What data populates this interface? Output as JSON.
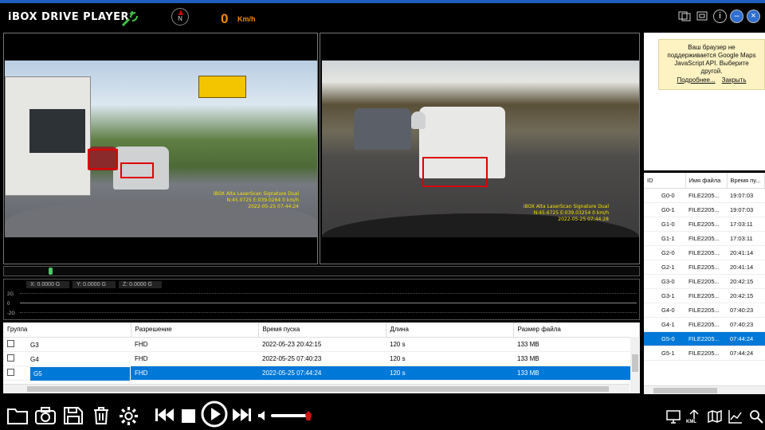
{
  "app": {
    "title": "iBOX DRIVE PLAYER",
    "compass_label": "N",
    "speed_value": "0",
    "speed_unit": "Km/h"
  },
  "video_left": {
    "overlay_line1": "iBOX Alta LaserScan Signature Dual",
    "overlay_line2": "N:45.0725  E:039.0264  0 km/h",
    "overlay_line3": "2022-05-25 07:44:24"
  },
  "video_right": {
    "overlay_line1": "iBOX Alta LaserScan Signature Dual",
    "overlay_line2": "N:45.6725  E:039.03254  0 km/h",
    "overlay_line3": "2022-05-25 07:44:28"
  },
  "gsensor": {
    "x_readout": "X: 0.0000 G",
    "y_readout": "Y: 0.0000 G",
    "z_readout": "Z: 0.0000 G",
    "scale_top": "2G",
    "scale_mid": "0",
    "scale_bottom": "-2G"
  },
  "file_table": {
    "headers": [
      "Группа",
      "Разрешение",
      "Время пуска",
      "Длина",
      "Размер файла"
    ],
    "rows": [
      {
        "group": "G3",
        "resolution": "FHD",
        "start": "2022-05-23 20:42:15",
        "length": "120 s",
        "size": "133 MB"
      },
      {
        "group": "G4",
        "resolution": "FHD",
        "start": "2022-05-25 07:40:23",
        "length": "120 s",
        "size": "133 MB"
      },
      {
        "group": "G5",
        "resolution": "FHD",
        "start": "2022-05-25 07:44:24",
        "length": "120 s",
        "size": "133 MB"
      }
    ]
  },
  "map": {
    "message": "Ваш браузер не поддерживается Google Maps JavaScript API. Выберите другой.",
    "more_link": "Подробнее...",
    "close_link": "Закрыть"
  },
  "file_list": {
    "headers": [
      "ID",
      "Имя файла",
      "Время пу..."
    ],
    "rows": [
      {
        "id": "G0-0",
        "name": "FILE2205...",
        "time": "19:07:03"
      },
      {
        "id": "G0-1",
        "name": "FILE2205...",
        "time": "19:07:03"
      },
      {
        "id": "G1-0",
        "name": "FILE2205...",
        "time": "17:03:11"
      },
      {
        "id": "G1-1",
        "name": "FILE2205...",
        "time": "17:03:11"
      },
      {
        "id": "G2-0",
        "name": "FILE2205...",
        "time": "20:41:14"
      },
      {
        "id": "G2-1",
        "name": "FILE2205...",
        "time": "20:41:14"
      },
      {
        "id": "G3-0",
        "name": "FILE2205...",
        "time": "20:42:15"
      },
      {
        "id": "G3-1",
        "name": "FILE2205...",
        "time": "20:42:15"
      },
      {
        "id": "G4-0",
        "name": "FILE2205...",
        "time": "07:40:23"
      },
      {
        "id": "G4-1",
        "name": "FILE2205...",
        "time": "07:40:23"
      },
      {
        "id": "G5-0",
        "name": "FILE2205...",
        "time": "07:44:24"
      },
      {
        "id": "G5-1",
        "name": "FILE2205...",
        "time": "07:44:24"
      }
    ],
    "selected_index": 10
  },
  "controls": {
    "kml_label": "KML",
    "icons": [
      "folder-icon",
      "camera-icon",
      "save-icon",
      "trash-icon",
      "settings-icon",
      "previous-icon",
      "stop-icon",
      "play-icon",
      "next-icon",
      "volume-icon"
    ],
    "right_icons": [
      "window-icon",
      "kml-icon",
      "map-icon",
      "chart-icon",
      "search-icon"
    ]
  },
  "colors": {
    "accent_blue": "#0078d7",
    "speed_orange": "#f08a00",
    "plate_box_red": "#e00000",
    "volume_red": "#d01515"
  }
}
